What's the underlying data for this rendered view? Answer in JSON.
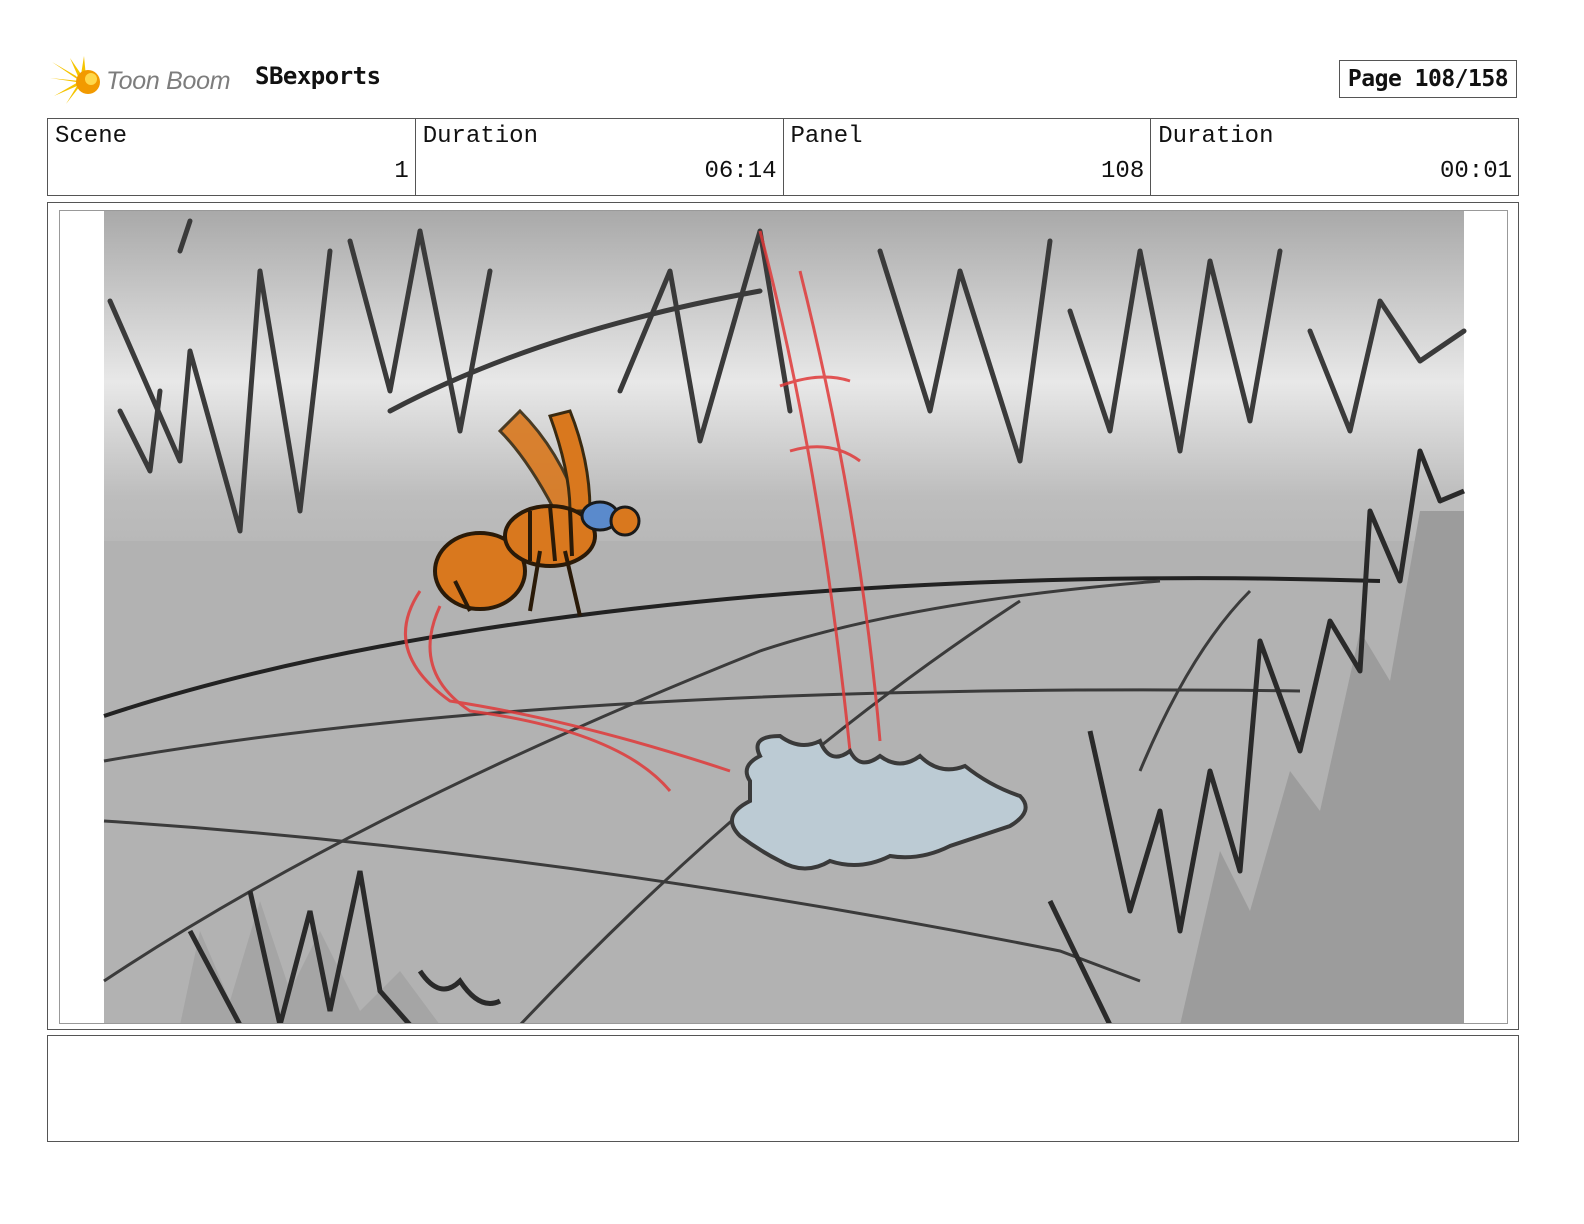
{
  "header": {
    "logo_text": "Toon Boom",
    "project_name": "SBexports",
    "page_label": "Page 108/158"
  },
  "info": {
    "scene_label": "Scene",
    "scene_value": "1",
    "scene_duration_label": "Duration",
    "scene_duration_value": "06:14",
    "panel_label": "Panel",
    "panel_value": "108",
    "panel_duration_label": "Duration",
    "panel_duration_value": "00:01"
  },
  "notes": {
    "text": ""
  },
  "colors": {
    "logo_yellow": "#f5c400",
    "logo_orange": "#f29a00",
    "bee_orange": "#d9781e",
    "motion_red": "#e03030",
    "puddle_blue": "#b8c8d2",
    "ground_gray": "#b0b0b0"
  }
}
